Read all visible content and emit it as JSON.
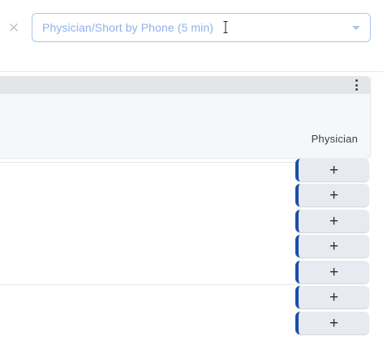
{
  "filter": {
    "close_icon": "close-icon",
    "selected_value": "Physician/Short by Phone (5 min)",
    "caret_icon": "chevron-down-icon"
  },
  "panel": {
    "menu_icon": "more-vert-icon",
    "column_label": "Physician"
  },
  "add_buttons": [
    {
      "label": "+"
    },
    {
      "label": "+"
    },
    {
      "label": "+"
    },
    {
      "label": "+"
    },
    {
      "label": "+"
    },
    {
      "label": "+"
    },
    {
      "label": "+"
    }
  ],
  "colors": {
    "accent": "#1a4fa8",
    "select_text": "#8db2ea",
    "select_border": "#a9c6ee"
  }
}
